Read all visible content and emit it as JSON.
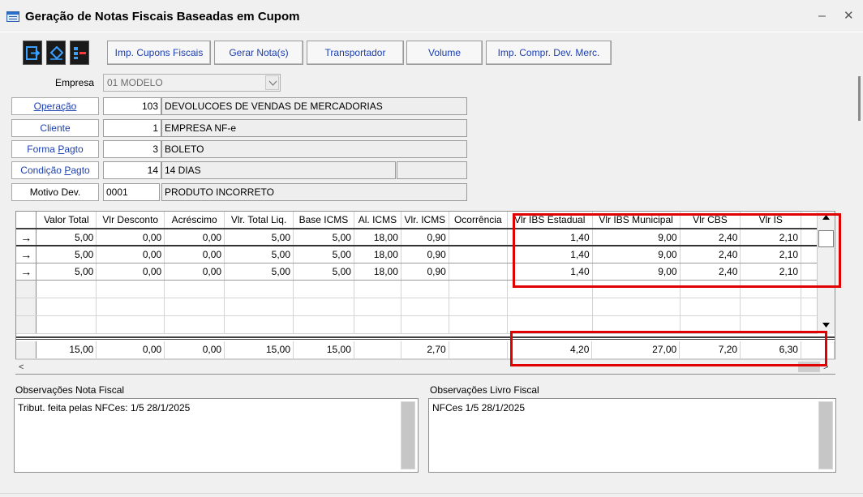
{
  "window": {
    "title": "Geração de Notas Fiscais Baseadas em Cupom",
    "minimize": "–",
    "close": "✕"
  },
  "toolbar": {
    "icons": [
      "exit-icon",
      "eraser-icon",
      "list-icon"
    ],
    "buttons": [
      {
        "label": "Imp. Cupons Fiscais"
      },
      {
        "label": "Gerar Nota(s)"
      },
      {
        "label": "Transportador"
      },
      {
        "label": "Volume"
      },
      {
        "label": "Imp. Compr. Dev. Merc."
      }
    ]
  },
  "form": {
    "empresa": {
      "label": "Empresa",
      "value": "01 MODELO"
    },
    "operacao": {
      "label": "Operação",
      "code": "103",
      "description": "DEVOLUCOES DE VENDAS DE MERCADORIAS"
    },
    "cliente": {
      "label": "Cliente",
      "code": "1",
      "description": "EMPRESA NF-e"
    },
    "forma_pagto": {
      "label_pre": "Forma ",
      "label_ul": "P",
      "label_post": "agto",
      "code": "3",
      "description": "BOLETO"
    },
    "condicao_pagto": {
      "label_pre": "Condição ",
      "label_ul": "P",
      "label_post": "agto",
      "code": "14",
      "description": "14 DIAS",
      "extra": ""
    },
    "motivo_dev": {
      "label": "Motivo Dev.",
      "code": "0001",
      "description": "PRODUTO INCORRETO"
    }
  },
  "grid": {
    "columns": [
      "Valor Total",
      "Vlr Desconto",
      "Acréscimo",
      "Vlr. Total Liq.",
      "Base ICMS",
      "Al. ICMS",
      "Vlr. ICMS",
      "Ocorrência",
      "Vlr IBS Estadual",
      "Vlr IBS Municipal",
      "Vlr CBS",
      "Vlr IS"
    ],
    "row_indicator": "→",
    "rows": [
      [
        "5,00",
        "0,00",
        "0,00",
        "5,00",
        "5,00",
        "18,00",
        "0,90",
        "",
        "1,40",
        "9,00",
        "2,40",
        "2,10"
      ],
      [
        "5,00",
        "0,00",
        "0,00",
        "5,00",
        "5,00",
        "18,00",
        "0,90",
        "",
        "1,40",
        "9,00",
        "2,40",
        "2,10"
      ],
      [
        "5,00",
        "0,00",
        "0,00",
        "5,00",
        "5,00",
        "18,00",
        "0,90",
        "",
        "1,40",
        "9,00",
        "2,40",
        "2,10"
      ]
    ],
    "totals": [
      "15,00",
      "0,00",
      "0,00",
      "15,00",
      "15,00",
      "",
      "2,70",
      "",
      "4,20",
      "27,00",
      "7,20",
      "6,30"
    ],
    "hscroll_left": "<",
    "hscroll_right": ">"
  },
  "observacoes": {
    "nota_fiscal": {
      "label": "Observações Nota Fiscal",
      "value": "Tribut. feita pelas NFCes: 1/5 28/1/2025"
    },
    "livro_fiscal": {
      "label": "Observações Livro Fiscal",
      "value": "NFCes 1/5 28/1/2025"
    }
  },
  "colors": {
    "link_text": "#1c3fb0",
    "highlight": "#e00000",
    "window_bg": "#f0f0f0"
  }
}
